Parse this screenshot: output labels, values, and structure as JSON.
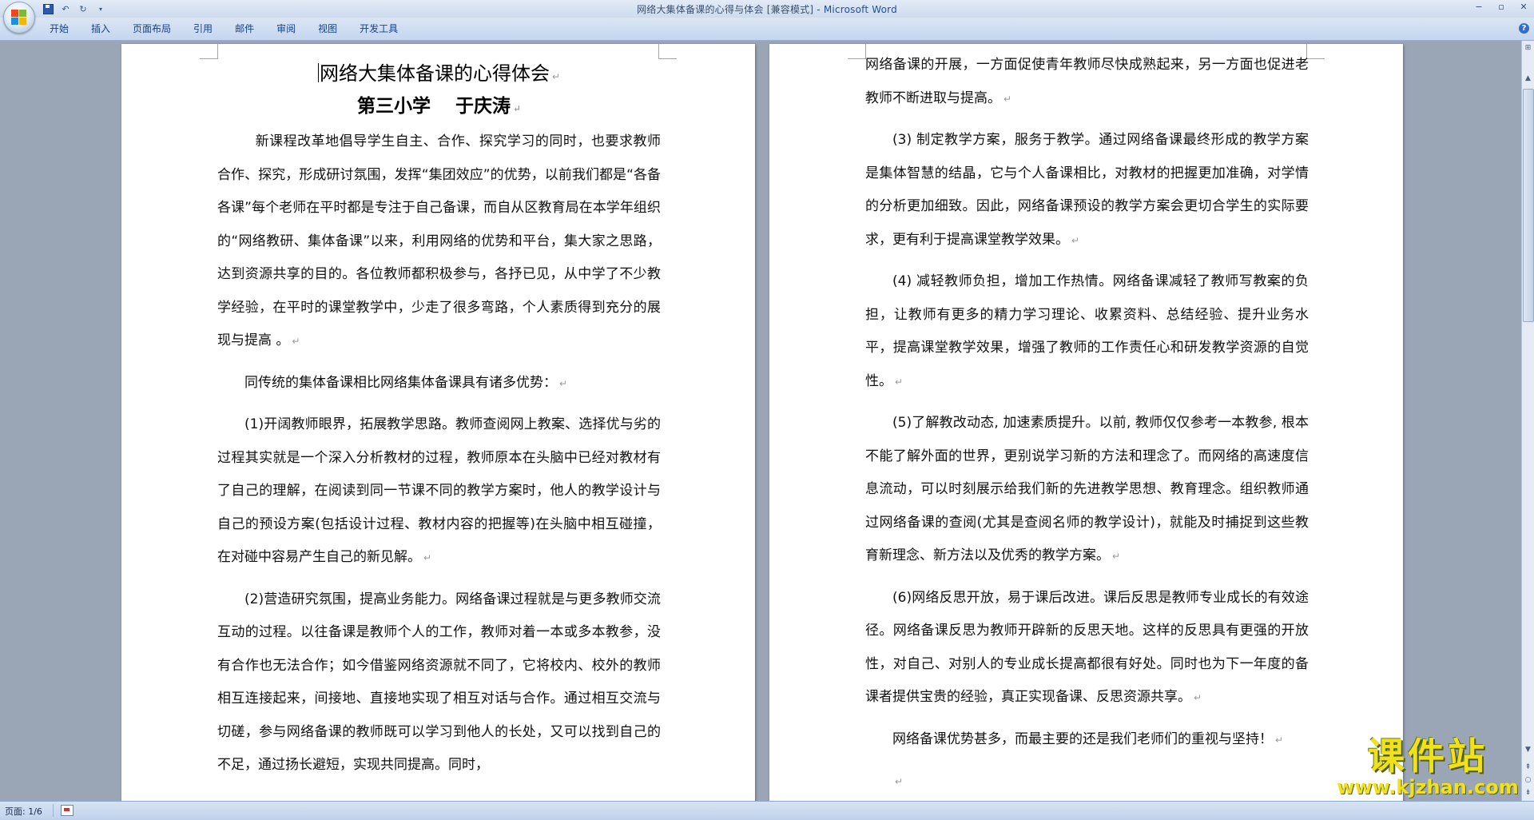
{
  "window": {
    "title": "网络大集体备课的心得与体会 [兼容模式] - ",
    "app_name": "Microsoft Word"
  },
  "quick_access": {
    "save_icon": "save-icon",
    "undo_icon": "undo-icon",
    "redo_icon": "redo-icon",
    "customize_icon": "dropdown-arrow-icon"
  },
  "window_controls": {
    "minimize": "−",
    "restore": "▫",
    "close": "✕"
  },
  "ribbon": {
    "tabs": [
      "开始",
      "插入",
      "页面布局",
      "引用",
      "邮件",
      "审阅",
      "视图",
      "开发工具"
    ],
    "help": "?"
  },
  "document": {
    "page1": {
      "title": "网络大集体备课的心得体会",
      "subtitle": "第三小学　 于庆涛",
      "paragraphs": [
        "新课程改革地倡导学生自主、合作、探究学习的同时，也要求教师合作、探究，形成研讨氛围，发挥“集团效应”的优势，以前我们都是“各备各课”每个老师在平时都是专注于自己备课，而自从区教育局在本学年组织的“网络教研、集体备课”以来，利用网络的优势和平台，集大家之思路，达到资源共享的目的。各位教师都积极参与，各抒已见，从中学了不少教学经验，在平时的课堂教学中，少走了很多弯路，个人素质得到充分的展现与提高 。",
        "同传统的集体备课相比网络集体备课具有诸多优势：",
        "(1)开阔教师眼界，拓展教学思路。教师查阅网上教案、选择优与劣的过程其实就是一个深入分析教材的过程，教师原本在头脑中已经对教材有了自己的理解，在阅读到同一节课不同的教学方案时，他人的教学设计与自己的预设方案(包括设计过程、教材内容的把握等)在头脑中相互碰撞，在对碰中容易产生自己的新见解。",
        "(2)营造研究氛围，提高业务能力。网络备课过程就是与更多教师交流互动的过程。以往备课是教师个人的工作，教师对着一本或多本教参，没有合作也无法合作；如今借鉴网络资源就不同了，它将校内、校外的教师相互连接起来，间接地、直接地实现了相互对话与合作。通过相互交流与切磋，参与网络备课的教师既可以学习到他人的长处，又可以找到自己的不足，通过扬长避短，实现共同提高。同时，"
      ]
    },
    "page2": {
      "paragraphs": [
        "网络备课的开展，一方面促使青年教师尽快成熟起来，另一方面也促进老教师不断进取与提高。",
        "(3) 制定教学方案，服务于教学。通过网络备课最终形成的教学方案是集体智慧的结晶，它与个人备课相比，对教材的把握更加准确，对学情的分析更加细致。因此，网络备课预设的教学方案会更切合学生的实际要求，更有利于提高课堂教学效果。",
        "(4) 减轻教师负担，增加工作热情。网络备课减轻了教师写教案的负担，让教师有更多的精力学习理论、收累资料、总结经验、提升业务水平，提高课堂教学效果，增强了教师的工作责任心和研发教学资源的自觉性。",
        "(5)了解教改动态, 加速素质提升。以前, 教师仅仅参考一本教参, 根本不能了解外面的世界，更别说学习新的方法和理念了。而网络的高速度信息流动，可以时刻展示给我们新的先进教学思想、教育理念。组织教师通过网络备课的查阅(尤其是查阅名师的教学设计)，就能及时捕捉到这些教育新理念、新方法以及优秀的教学方案。",
        "(6)网络反思开放，易于课后改进。课后反思是教师专业成长的有效途径。网络备课反思为教师开辟新的反思天地。这样的反思具有更强的开放性，对自己、对别人的专业成长提高都很有好处。同时也为下一年度的备课者提供宝贵的经验，真正实现备课、反思资源共享。",
        "网络备课优势甚多，而最主要的还是我们老师们的重视与坚持！"
      ]
    },
    "paragraph_mark": "↵"
  },
  "statusbar": {
    "page_indicator": "页面: 1/6"
  },
  "watermark": {
    "main": "课件站",
    "url": "www.kjzhan.com"
  }
}
